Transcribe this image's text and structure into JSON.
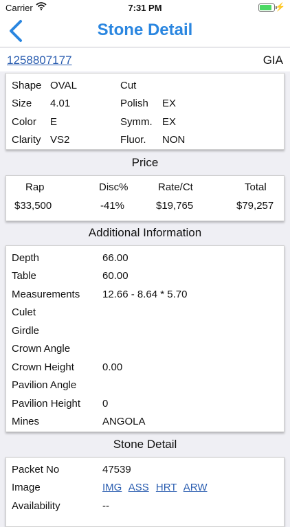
{
  "status_bar": {
    "carrier": "Carrier",
    "time": "7:31 PM"
  },
  "nav": {
    "title": "Stone Detail"
  },
  "stone": {
    "id": "1258807177",
    "lab": "GIA"
  },
  "specs": {
    "left": [
      {
        "label": "Shape",
        "value": "OVAL"
      },
      {
        "label": "Size",
        "value": "4.01"
      },
      {
        "label": "Color",
        "value": "E"
      },
      {
        "label": "Clarity",
        "value": "VS2"
      }
    ],
    "right": [
      {
        "label": "Cut",
        "value": ""
      },
      {
        "label": "Polish",
        "value": "EX"
      },
      {
        "label": "Symm.",
        "value": "EX"
      },
      {
        "label": "Fluor.",
        "value": "NON"
      }
    ]
  },
  "price": {
    "title": "Price",
    "headers": [
      "Rap",
      "Disc%",
      "Rate/Ct",
      "Total"
    ],
    "values": [
      "$33,500",
      "-41%",
      "$19,765",
      "$79,257"
    ]
  },
  "additional": {
    "title": "Additional Information",
    "rows": [
      {
        "label": "Depth",
        "value": "66.00"
      },
      {
        "label": "Table",
        "value": "60.00"
      },
      {
        "label": "Measurements",
        "value": "12.66 - 8.64 * 5.70"
      },
      {
        "label": "Culet",
        "value": ""
      },
      {
        "label": "Girdle",
        "value": ""
      },
      {
        "label": "Crown Angle",
        "value": ""
      },
      {
        "label": "Crown Height",
        "value": "0.00"
      },
      {
        "label": "Pavilion Angle",
        "value": ""
      },
      {
        "label": "Pavilion Height",
        "value": "0"
      },
      {
        "label": "Mines",
        "value": "ANGOLA"
      }
    ]
  },
  "stone_detail": {
    "title": "Stone Detail",
    "packet_label": "Packet No",
    "packet_value": "47539",
    "image_label": "Image",
    "image_links": [
      "IMG",
      "ASS",
      "HRT",
      "ARW"
    ],
    "availability_label": "Availability",
    "availability_value": "--"
  },
  "colors": {
    "accent": "#2a86e0",
    "link": "#2a5db0",
    "battery": "#4cd964"
  }
}
